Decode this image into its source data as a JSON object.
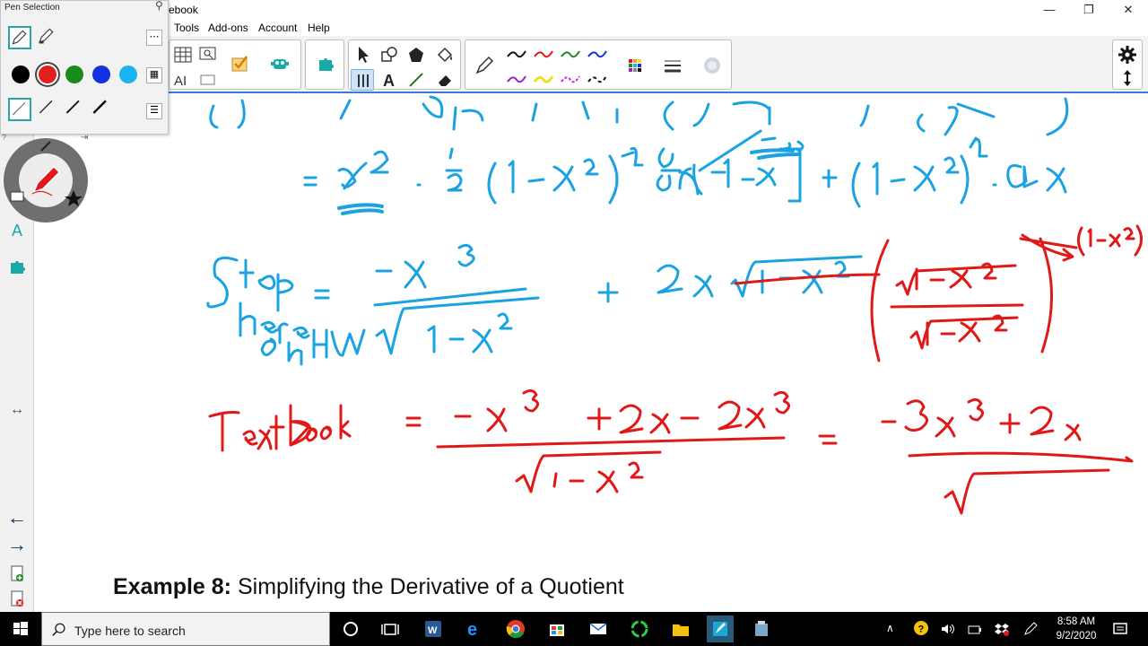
{
  "window": {
    "title_fragment": "ebook",
    "minimize_glyph": "—",
    "restore_glyph": "❐",
    "close_glyph": "✕"
  },
  "menu": {
    "items": [
      "Tools",
      "Add-ons",
      "Account",
      "Help"
    ]
  },
  "pen_popup": {
    "title": "Pen Selection",
    "colors": [
      "#000000",
      "#e02020",
      "#1a8a1a",
      "#1430e0",
      "#1ab4f0"
    ]
  },
  "canvas": {
    "example_bold": "Example 8:",
    "example_rest": " Simplifying the Derivative of a Quotient",
    "handwriting_blue": "= x² · ½ (1 − x²)^−½ d/dx[1 − x²] + (1 − x²)^½ · 2x ; Stop here on HW = −x³ / √(1 − x²) + 2x √(1 − x²)",
    "handwriting_red": "TextBook = (−x³ + 2x − 2x³) / √(1 − x²) = (−3x³ + 2x) / √ ; (√(1−x²) / √(1−x²)) → (1 − x²)",
    "ink_colors": {
      "blue": "#1aa3e0",
      "red": "#e01818"
    }
  },
  "taskbar": {
    "search_placeholder": "Type here to search",
    "time": "8:58 AM",
    "date": "9/2/2020"
  }
}
